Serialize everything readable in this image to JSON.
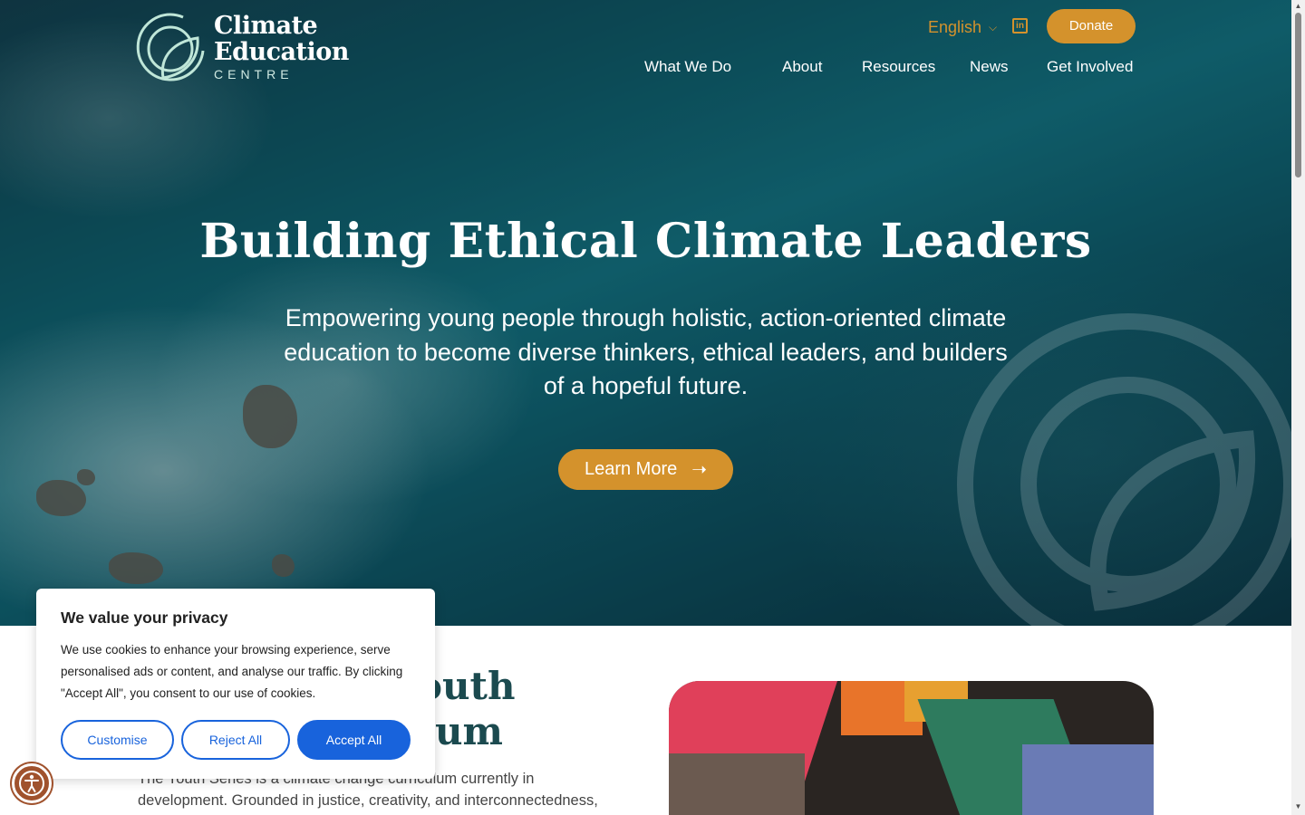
{
  "logo": {
    "line1": "Climate",
    "line2": "Education",
    "line3": "CENTRE"
  },
  "header": {
    "language": "English",
    "donate_label": "Donate"
  },
  "nav": {
    "items": [
      "What We Do",
      "About",
      "Resources",
      "News",
      "Get Involved"
    ]
  },
  "hero": {
    "title": "Building Ethical Climate Leaders",
    "subtitle": "Empowering young people through holistic, action-oriented climate education to become diverse thinkers, ethical leaders, and builders of a hopeful future.",
    "cta_label": "Learn More"
  },
  "section": {
    "heading_line1": "outh",
    "heading_line2": "um",
    "text": "The Youth Series is a climate change curriculum currently in development. Grounded in justice, creativity, and interconnectedness,"
  },
  "cookie": {
    "title": "We value your privacy",
    "text": "We use cookies to enhance your browsing experience, serve personalised ads or content, and analyse our traffic. By clicking \"Accept All\", you consent to our use of cookies.",
    "customise_label": "Customise",
    "reject_label": "Reject All",
    "accept_label": "Accept All"
  },
  "colors": {
    "accent": "#d4922c",
    "cookie_blue": "#1863dc",
    "heading_green": "#1b4a4f"
  },
  "icons": {
    "language_chevron": "chevron-down-icon",
    "linkedin": "linkedin-icon",
    "cta_arrow": "arrow-right-icon",
    "accessibility": "accessibility-icon"
  }
}
